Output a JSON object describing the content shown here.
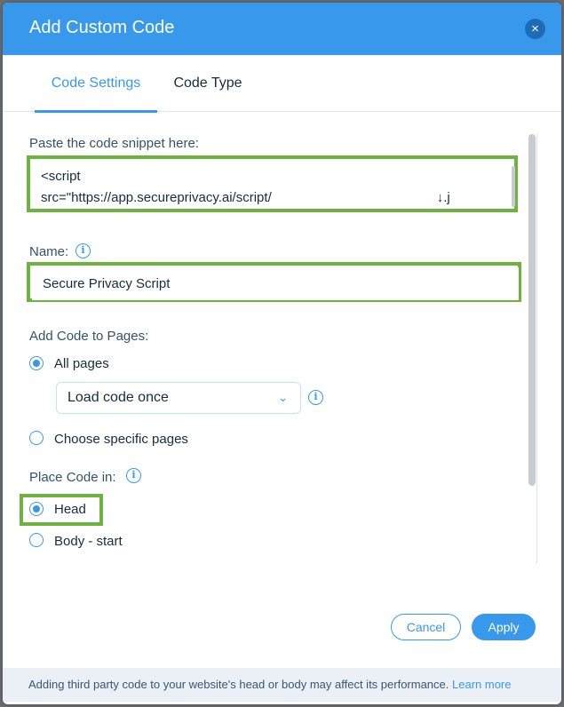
{
  "dialog": {
    "title": "Add Custom Code",
    "close_glyph": "×"
  },
  "tabs": [
    {
      "label": "Code Settings",
      "active": true
    },
    {
      "label": "Code Type",
      "active": false
    }
  ],
  "code_snippet": {
    "label": "Paste the code snippet here:",
    "line1": "<script",
    "line2": "src=\"https://app.secureprivacy.ai/script/",
    "line2_tail": "↓.j"
  },
  "name_field": {
    "label": "Name:",
    "value": "Secure Privacy Script"
  },
  "add_code_to_pages": {
    "label": "Add Code to Pages:",
    "options": [
      {
        "label": "All pages",
        "checked": true
      },
      {
        "label": "Choose specific pages",
        "checked": false
      }
    ],
    "load_select": {
      "value": "Load code once"
    }
  },
  "place_code_in": {
    "label": "Place Code in:",
    "options": [
      {
        "label": "Head",
        "checked": true
      },
      {
        "label": "Body - start",
        "checked": false
      }
    ]
  },
  "buttons": {
    "cancel": "Cancel",
    "apply": "Apply"
  },
  "footer": {
    "text": "Adding third party code to your website's head or body may affect its performance. ",
    "link": "Learn more"
  },
  "colors": {
    "accent": "#3899ec",
    "highlight": "#6eb33f"
  }
}
